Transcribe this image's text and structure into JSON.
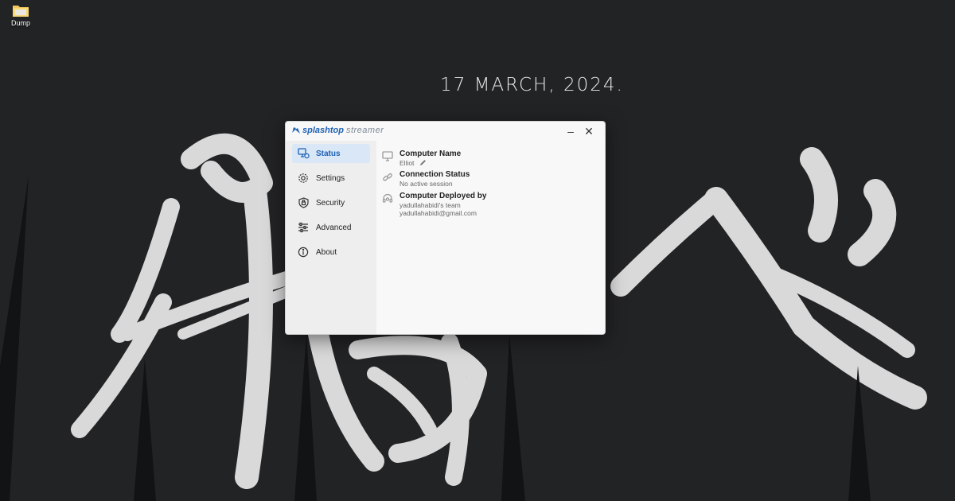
{
  "desktop": {
    "icons": [
      {
        "label": "Dump",
        "icon": "folder-icon"
      }
    ],
    "date": "17 MARCH, 2024.",
    "wallpaper_bg": "#222325"
  },
  "window": {
    "brand": {
      "name": "splashtop",
      "product": "streamer",
      "accent": "#1e61b3"
    },
    "controls": {
      "minimize": "–",
      "close": "✕"
    },
    "nav": [
      {
        "label": "Status",
        "icon": "status-icon",
        "active": true
      },
      {
        "label": "Settings",
        "icon": "gear-icon",
        "active": false
      },
      {
        "label": "Security",
        "icon": "shield-lock-icon",
        "active": false
      },
      {
        "label": "Advanced",
        "icon": "sliders-icon",
        "active": false
      },
      {
        "label": "About",
        "icon": "info-icon",
        "active": false
      }
    ],
    "status": {
      "computer_name": {
        "title": "Computer Name",
        "value": "Elliot"
      },
      "connection_status": {
        "title": "Connection Status",
        "value": "No active session"
      },
      "deployed_by": {
        "title": "Computer Deployed by",
        "team": "yadullahabidi's team",
        "email": "yadullahabidi@gmail.com"
      }
    }
  }
}
